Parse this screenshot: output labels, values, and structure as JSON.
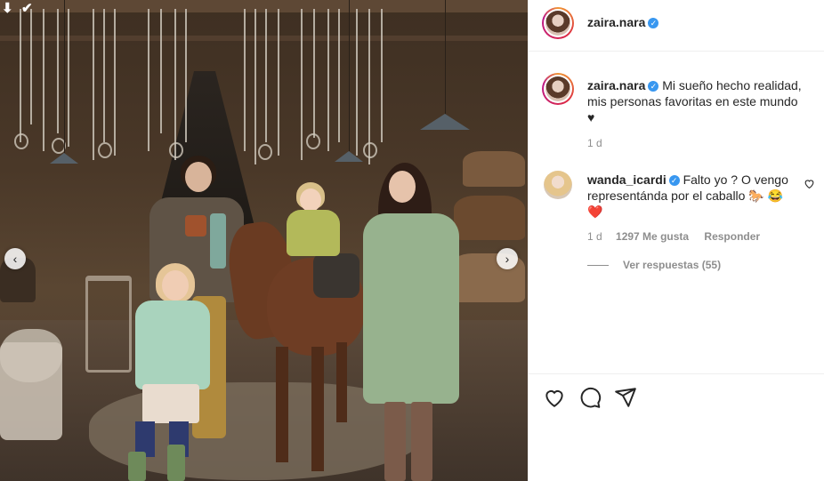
{
  "post": {
    "author": "zaira.nara",
    "verified_icon": "verified-badge-icon",
    "accent_color": "#3897f0"
  },
  "caption": {
    "author": "zaira.nara",
    "text": "Mi sueño hecho realidad, mis personas favoritas en este mundo",
    "heart": "♥",
    "time": "1 d"
  },
  "comment": {
    "author": "wanda_icardi",
    "text": "Falto yo ? O vengo representánda por el caballo 🐎 😂",
    "heart": "❤️",
    "time": "1 d",
    "likes": "1297 Me gusta",
    "reply": "Responder",
    "view_replies": "Ver respuestas (55)"
  },
  "photo": {
    "prev_icon": "‹",
    "next_icon": "›",
    "corner_icons": [
      "arrow-down-icon",
      "double-check-icon"
    ]
  },
  "actions": [
    "heart-icon",
    "comment-icon",
    "share-icon"
  ]
}
